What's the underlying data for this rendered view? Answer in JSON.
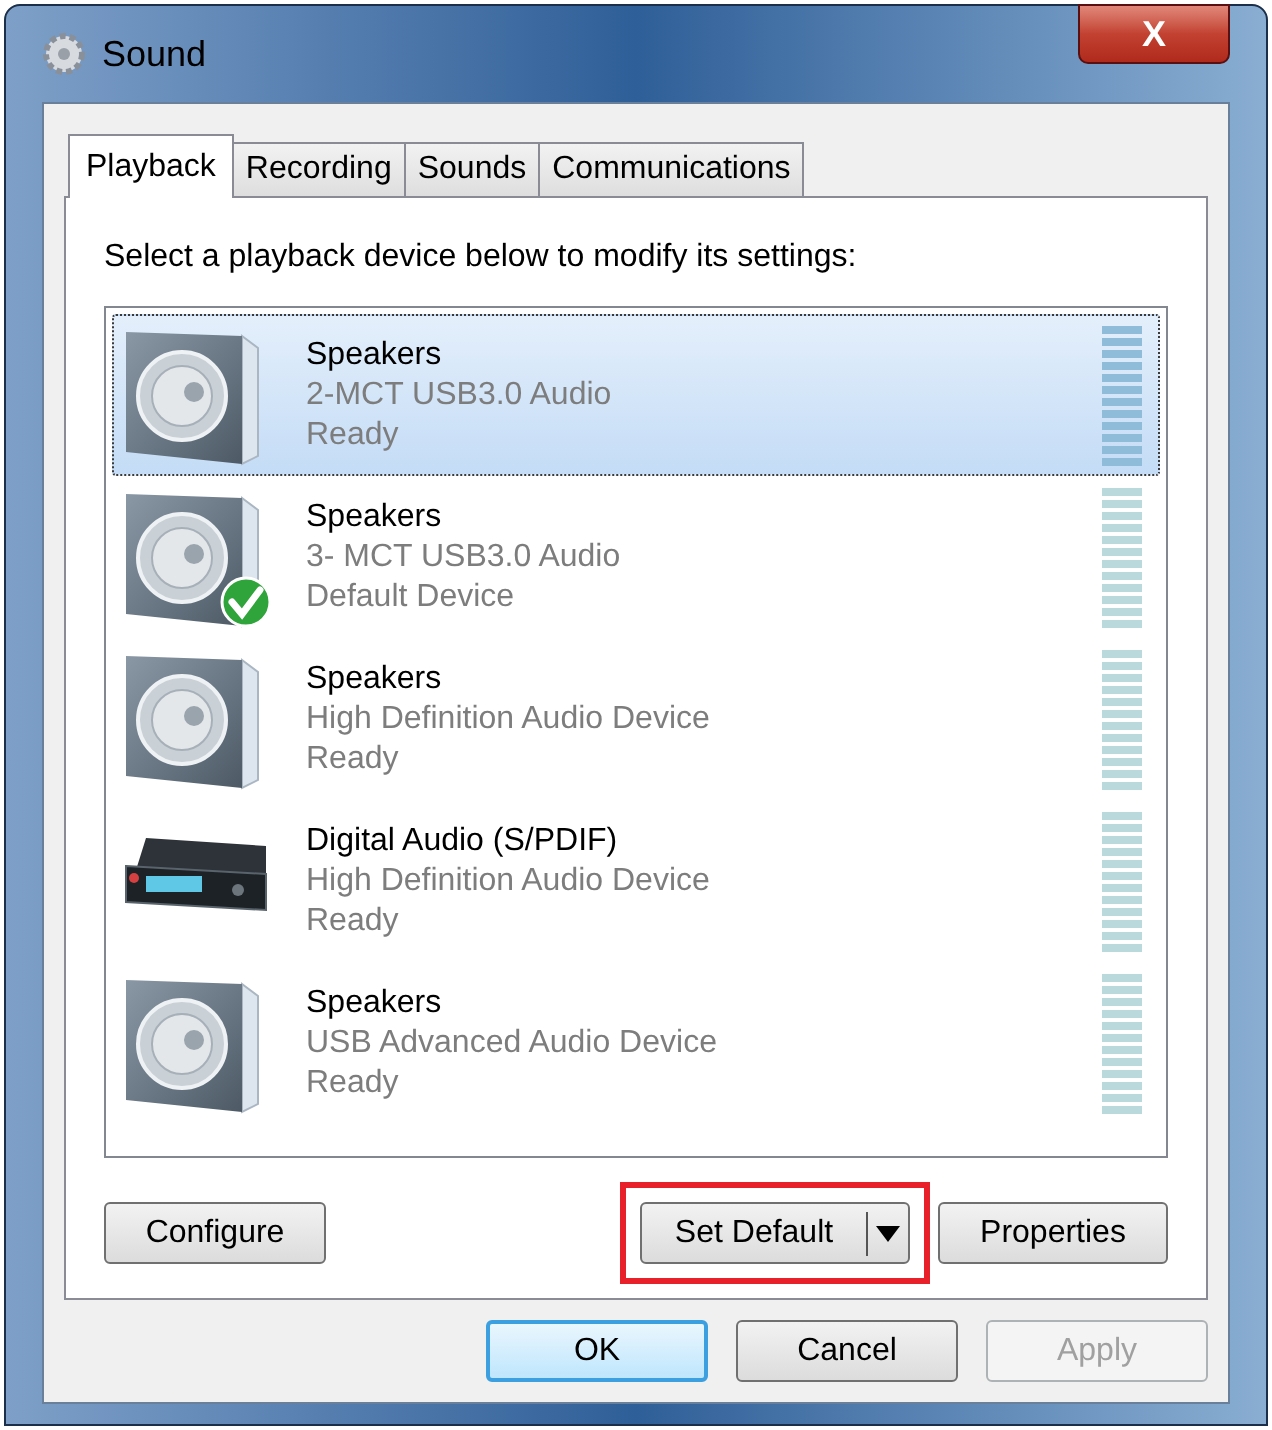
{
  "window": {
    "title": "Sound",
    "close_label": "X"
  },
  "tabs": [
    {
      "label": "Playback",
      "selected": true
    },
    {
      "label": "Recording",
      "selected": false
    },
    {
      "label": "Sounds",
      "selected": false
    },
    {
      "label": "Communications",
      "selected": false
    }
  ],
  "prompt": "Select a playback device below to modify its settings:",
  "devices": [
    {
      "kind": "speaker",
      "name": "Speakers",
      "description": "2-MCT USB3.0 Audio",
      "status": "Ready",
      "selected": true,
      "default": false
    },
    {
      "kind": "speaker",
      "name": "Speakers",
      "description": "3- MCT USB3.0 Audio",
      "status": "Default Device",
      "selected": false,
      "default": true
    },
    {
      "kind": "speaker",
      "name": "Speakers",
      "description": "High Definition Audio Device",
      "status": "Ready",
      "selected": false,
      "default": false
    },
    {
      "kind": "digital",
      "name": "Digital Audio (S/PDIF)",
      "description": "High Definition Audio Device",
      "status": "Ready",
      "selected": false,
      "default": false
    },
    {
      "kind": "speaker",
      "name": "Speakers",
      "description": "USB Advanced Audio Device",
      "status": "Ready",
      "selected": false,
      "default": false
    }
  ],
  "panel_buttons": {
    "configure": "Configure",
    "set_default": {
      "label": "Set Default",
      "highlighted": true
    },
    "properties": "Properties"
  },
  "dialog_buttons": [
    {
      "label": "OK",
      "default": true,
      "disabled": false
    },
    {
      "label": "Cancel",
      "default": false,
      "disabled": false
    },
    {
      "label": "Apply",
      "default": false,
      "disabled": true
    }
  ]
}
